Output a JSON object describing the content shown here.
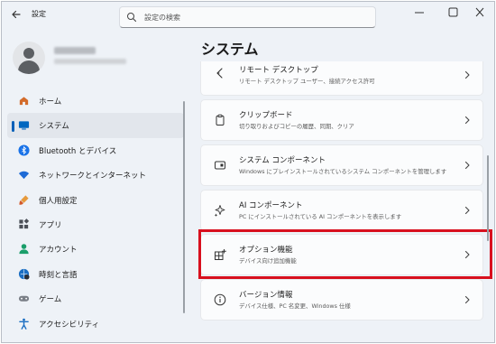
{
  "app": {
    "title": "設定",
    "back_icon": "back-arrow-icon"
  },
  "search": {
    "placeholder": "設定の検索"
  },
  "window_controls": {
    "minimize": "minimize-icon",
    "maximize": "maximize-icon",
    "close": "close-icon"
  },
  "profile": {
    "avatar_icon": "user-avatar-icon"
  },
  "nav": {
    "items": [
      {
        "label": "ホーム",
        "icon": "home-icon",
        "color": "#d36b2a"
      },
      {
        "label": "システム",
        "icon": "monitor-icon",
        "color": "#0067c0",
        "active": true
      },
      {
        "label": "Bluetooth とデバイス",
        "icon": "bluetooth-icon",
        "color": "#1a73e8"
      },
      {
        "label": "ネットワークとインターネット",
        "icon": "wifi-icon",
        "color": "#1e6bd6"
      },
      {
        "label": "個人用設定",
        "icon": "brush-icon",
        "color": "#d35a2a"
      },
      {
        "label": "アプリ",
        "icon": "apps-icon",
        "color": "#4b4f57"
      },
      {
        "label": "アカウント",
        "icon": "account-icon",
        "color": "#1a9e6a"
      },
      {
        "label": "時刻と言語",
        "icon": "globe-icon",
        "color": "#1b6ec2"
      },
      {
        "label": "ゲーム",
        "icon": "gamepad-icon",
        "color": "#7a7f87"
      },
      {
        "label": "アクセシビリティ",
        "icon": "accessibility-icon",
        "color": "#1b6ec2"
      }
    ]
  },
  "main": {
    "title": "システム",
    "cards": [
      {
        "title": "リモート デスクトップ",
        "desc": "リモート デスクトップ ユーザー、接続アクセス許可",
        "icon": "remote-desktop-icon"
      },
      {
        "title": "クリップボード",
        "desc": "切り取りおよびコピーの履歴、同期、クリア",
        "icon": "clipboard-icon"
      },
      {
        "title": "システム コンポーネント",
        "desc": "Windows にプレインストールされているシステム コンポーネントを管理します",
        "icon": "system-components-icon"
      },
      {
        "title": "AI コンポーネント",
        "desc": "PC にインストールされている AI コンポーネントを表示します",
        "icon": "ai-sparkle-icon"
      },
      {
        "title": "オプション機能",
        "desc": "デバイス向け追加機能",
        "icon": "optional-features-icon"
      },
      {
        "title": "バージョン情報",
        "desc": "デバイス仕様、PC 名変更、Windows 仕様",
        "icon": "info-icon"
      }
    ]
  },
  "highlight_color": "#d8101e"
}
